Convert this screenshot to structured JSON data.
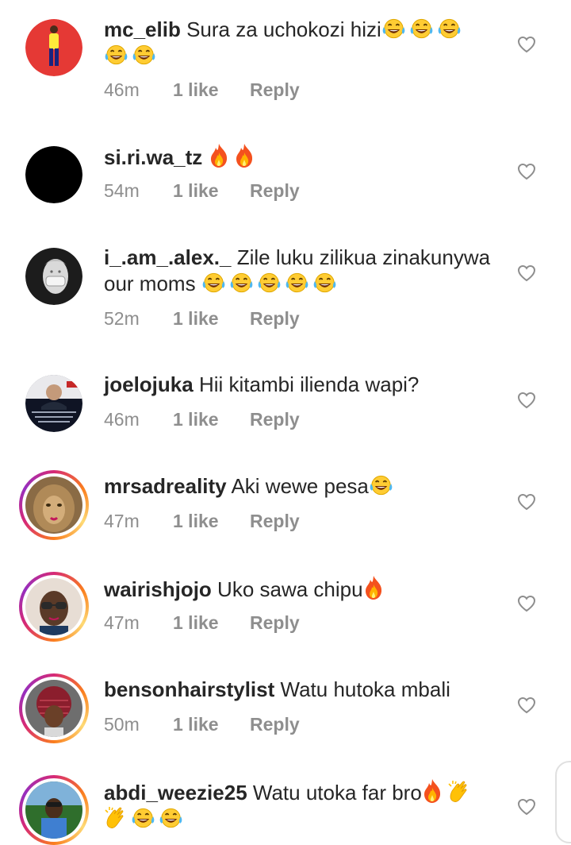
{
  "comments": [
    {
      "username": "mc_elib",
      "text": "Sura za uchokozi hizi",
      "emojis": [
        "laughing-emoji",
        "laughing-emoji",
        "laughing-emoji",
        "laughing-emoji",
        "laughing-emoji"
      ],
      "time": "46m",
      "likes": "1 like",
      "reply": "Reply",
      "avatar_color": "#e53935"
    },
    {
      "username": "si.ri.wa_tz",
      "text": "",
      "emojis": [
        "fire-emoji",
        "fire-emoji"
      ],
      "time": "54m",
      "likes": "1 like",
      "reply": "Reply",
      "avatar_color": "#000000"
    },
    {
      "username": "i_.am_.alex._",
      "text": "Zile luku zilikua zinakunywa our moms",
      "emojis": [
        "laughing-emoji",
        "laughing-emoji",
        "laughing-emoji",
        "laughing-emoji",
        "laughing-emoji"
      ],
      "time": "52m",
      "likes": "1 like",
      "reply": "Reply",
      "avatar_color": "#2b2b2b"
    },
    {
      "username": "joelojuka",
      "text": "Hii kitambi ilienda wapi?",
      "emojis": [],
      "time": "46m",
      "likes": "1 like",
      "reply": "Reply",
      "avatar_color": "#1a1f2e"
    },
    {
      "username": "mrsadreality",
      "text": "Aki wewe pesa",
      "emojis": [
        "laughing-emoji"
      ],
      "time": "47m",
      "likes": "1 like",
      "reply": "Reply",
      "avatar_color": "#a07a4a"
    },
    {
      "username": "wairishjojo",
      "text": "Uko sawa chipu",
      "emojis": [
        "fire-emoji"
      ],
      "time": "47m",
      "likes": "1 like",
      "reply": "Reply",
      "avatar_color": "#d8c7b8"
    },
    {
      "username": "bensonhairstylist",
      "text": "Watu hutoka mbali",
      "emojis": [],
      "time": "50m",
      "likes": "1 like",
      "reply": "Reply",
      "avatar_color": "#7a3b3b"
    },
    {
      "username": "abdi_weezie25",
      "text": "Watu utoka far bro",
      "emojis": [
        "fire-emoji",
        "clap-emoji",
        "clap-emoji",
        "laughing-emoji",
        "laughing-emoji"
      ],
      "time": "",
      "likes": "",
      "reply": "",
      "avatar_color": "#3d7a3a"
    }
  ],
  "colors": {
    "text": "#262626",
    "muted": "#8e8e8e",
    "story_ring_start": "#d62976",
    "story_ring_end": "#fa7e1e"
  }
}
